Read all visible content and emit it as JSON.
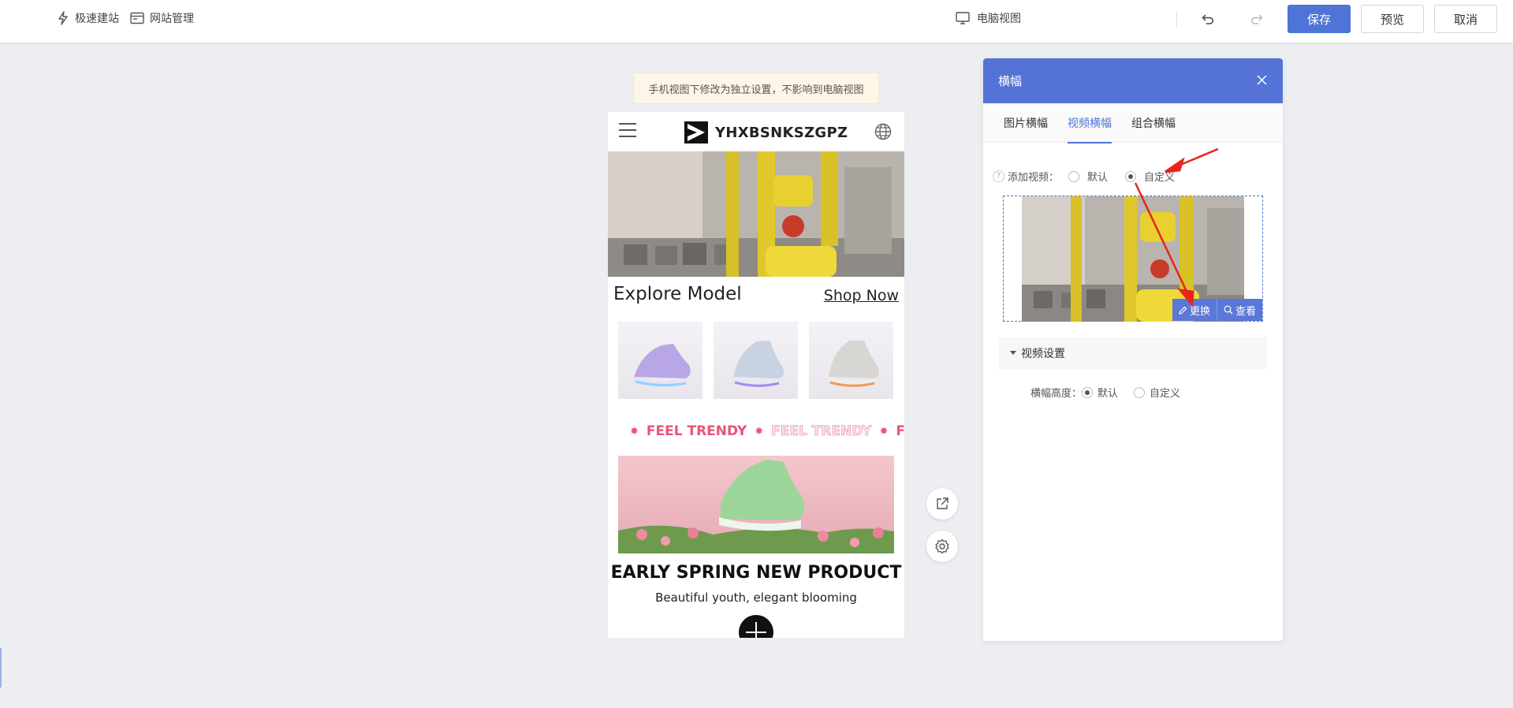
{
  "topbar": {
    "quick_build": "极速建站",
    "site_manage": "网站管理",
    "desktop_view": "电脑视图",
    "save": "保存",
    "preview": "预览",
    "cancel": "取消"
  },
  "notice": "手机视图下修改为独立设置，不影响到电脑视图",
  "phone": {
    "logo_text": "YHXBSNKSZGPZ",
    "explore": "Explore Model",
    "shop_now": "Shop Now",
    "ticker": [
      "FEEL TRENDY",
      "FEEL TRENDY",
      "FI"
    ],
    "title": "EARLY SPRING NEW PRODUCT",
    "subtitle": "Beautiful youth, elegant blooming"
  },
  "panel": {
    "title": "横幅",
    "tabs": [
      "图片横幅",
      "视频横幅",
      "组合横幅"
    ],
    "active_tab": 1,
    "add_video_label": "添加视频：",
    "video_option_default": "默认",
    "video_option_custom": "自定义",
    "replace": "更换",
    "view": "查看",
    "video_settings": "视频设置",
    "banner_height_label": "横幅高度：",
    "height_default": "默认",
    "height_custom": "自定义"
  },
  "colors": {
    "accent": "#4f73d6",
    "panel_head": "#5573d6",
    "ticker": "#e8547a",
    "arrow": "#e8241c"
  }
}
